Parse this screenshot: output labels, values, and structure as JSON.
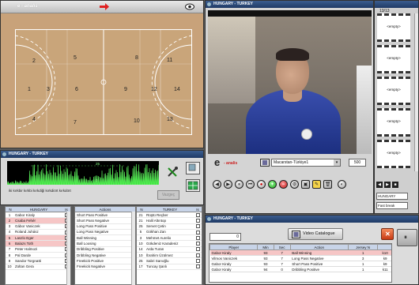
{
  "court_panel": {
    "logo": "e - analis",
    "zones": [
      "1",
      "2",
      "3",
      "4",
      "5",
      "6",
      "7",
      "8",
      "9",
      "10",
      "11",
      "12",
      "13",
      "14"
    ]
  },
  "video_panel": {
    "title": "HUNGARY - TURKEY",
    "logo_e": "e",
    "logo_text": "- analis",
    "match_select": "Macarstan-Türkiye1",
    "speed_value": "500"
  },
  "clip_panel": {
    "counter": "13/13",
    "slot_label": "<empty>",
    "team_select": "HUNGARY",
    "phase_select": "Fast break"
  },
  "graph_panel": {
    "title": "HUNGARY - TURKEY",
    "level_top": "25",
    "level_bottom": "0",
    "caption": "iki kırkbir kırkbi kırkdiği kırkdiört kırkdört",
    "button_label": "Vazgeç"
  },
  "home_team": {
    "header_n": "N",
    "header_team": "HUNGARY",
    "header_is": "Is",
    "players": [
      {
        "n": "1",
        "name": "Gabor Kiraly",
        "c": false,
        "hl": false
      },
      {
        "n": "2",
        "name": "Csaba Fehér",
        "c": true,
        "hl": true
      },
      {
        "n": "3",
        "name": "Gábor Vaniczek",
        "c": true,
        "hl": false
      },
      {
        "n": "4",
        "name": "Roland Juhász",
        "c": false,
        "hl": false
      },
      {
        "n": "5",
        "name": "Laszlo Eger",
        "c": true,
        "hl": true
      },
      {
        "n": "6",
        "name": "Balazs Toth",
        "c": true,
        "hl": true
      },
      {
        "n": "7",
        "name": "Peter Halmozi",
        "c": false,
        "hl": false
      },
      {
        "n": "8",
        "name": "Pal Darde",
        "c": false,
        "hl": false
      },
      {
        "n": "9",
        "name": "Sandor Torgnatti",
        "c": false,
        "hl": false
      },
      {
        "n": "10",
        "name": "Zoltan Gera",
        "c": false,
        "hl": false
      }
    ]
  },
  "actions": {
    "header": "Actions",
    "items": [
      "Short Pass Positive",
      "Short Pass Negative",
      "Long Pass Positive",
      "Long Pass Negative",
      "Ball Winning",
      "Ball Loosing",
      "Dribbling Positive",
      "Dribbling Negative",
      "Freekick Positive",
      "Freekick Negative"
    ]
  },
  "away_team": {
    "header_n": "N",
    "header_team": "TURKEY",
    "header_is": "Is",
    "players": [
      {
        "n": "21",
        "name": "Rüştü Reçber"
      },
      {
        "n": "21",
        "name": "Halil Altıntop"
      },
      {
        "n": "25",
        "name": "Servet Çetin"
      },
      {
        "n": "5",
        "name": "Gökhan Zan"
      },
      {
        "n": "3",
        "name": "Mehmet Aurelio"
      },
      {
        "n": "10",
        "name": "Gökdeniz Karadeniz"
      },
      {
        "n": "14",
        "name": "Arda Turan"
      },
      {
        "n": "10",
        "name": "İbrahim Üzülmez"
      },
      {
        "n": "25",
        "name": "Sabri Sarıoğlu"
      },
      {
        "n": "17",
        "name": "Tuncay Şanlı"
      }
    ]
  },
  "events": {
    "title": "HUNGARY - TURKEY",
    "search_value": "0",
    "catalogue_button": "Video Catalogue",
    "columns": [
      "Player",
      "Min",
      "Sec",
      "Action",
      "Jersey N",
      ""
    ],
    "rows": [
      [
        "Gabor Kiraly",
        "93",
        "7",
        "Ball Winning",
        "1",
        "k10"
      ],
      [
        "Vilmos Vaniczek",
        "93",
        "7",
        "Long Pass Negative",
        "3",
        "k9"
      ],
      [
        "Gabor Kiraly",
        "93",
        "7",
        "Short Pass Positive",
        "1",
        "k9"
      ],
      [
        "Gabor Kiraly",
        "94",
        "0",
        "Dribbling Positive",
        "1",
        "k11"
      ]
    ]
  }
}
